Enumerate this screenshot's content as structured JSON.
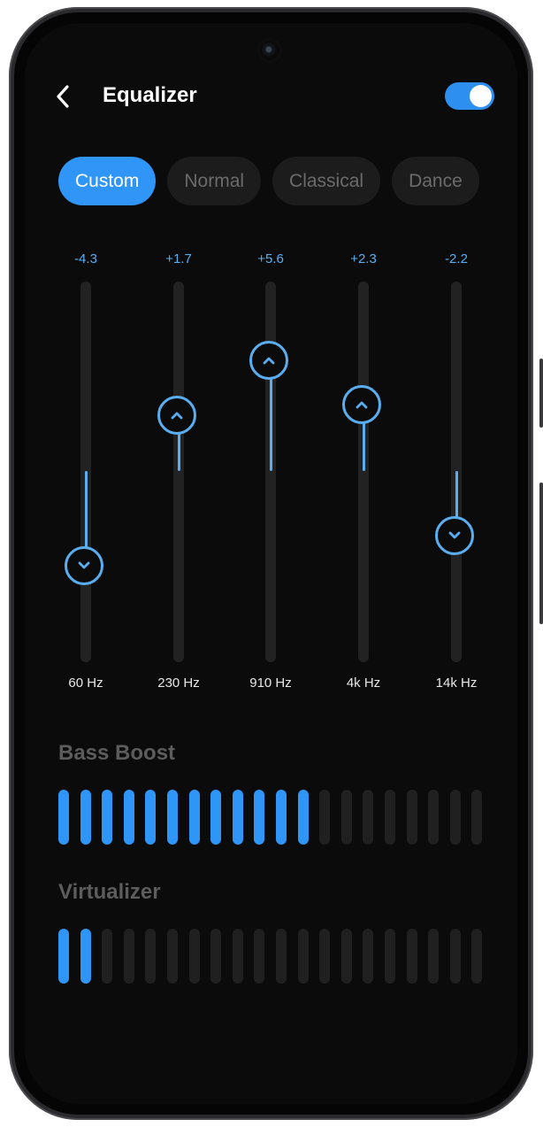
{
  "header": {
    "title": "Equalizer",
    "back_icon": "chevron-left-icon",
    "enabled": true
  },
  "colors": {
    "accent": "#2f95f7",
    "slider_accent": "#5aaef0",
    "background": "#0b0b0b",
    "inactive": "#202020"
  },
  "presets": [
    {
      "label": "Custom",
      "active": true
    },
    {
      "label": "Normal",
      "active": false
    },
    {
      "label": "Classical",
      "active": false
    },
    {
      "label": "Dance",
      "active": false
    }
  ],
  "bands": [
    {
      "freq": "60 Hz",
      "value_label": "-4.3",
      "value": -4.3
    },
    {
      "freq": "230 Hz",
      "value_label": "+1.7",
      "value": 1.7
    },
    {
      "freq": "910 Hz",
      "value_label": "+5.6",
      "value": 5.6
    },
    {
      "freq": "4k Hz",
      "value_label": "+2.3",
      "value": 2.3
    },
    {
      "freq": "14k Hz",
      "value_label": "-2.2",
      "value": -2.2
    }
  ],
  "bass_boost": {
    "label": "Bass Boost",
    "level": 12,
    "segments": 20
  },
  "virtualizer": {
    "label": "Virtualizer",
    "level": 2,
    "segments": 20
  }
}
